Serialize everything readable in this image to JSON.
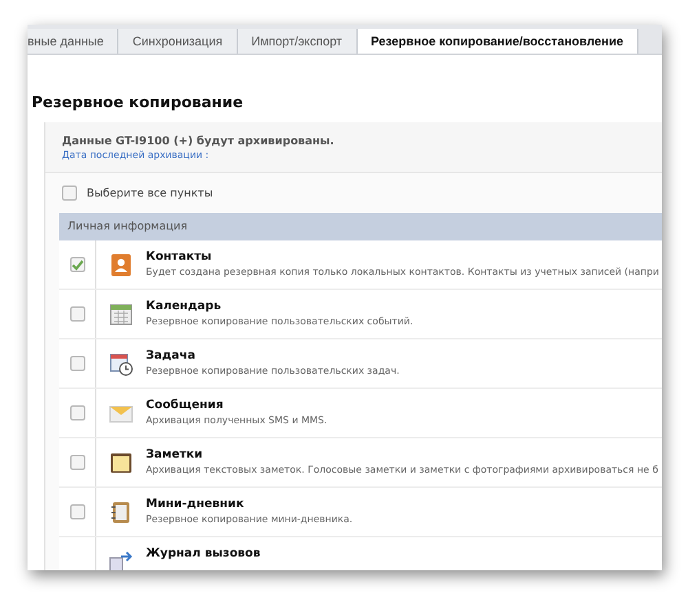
{
  "tabs": [
    {
      "label": "вные данные",
      "selected": false
    },
    {
      "label": "Синхронизация",
      "selected": false
    },
    {
      "label": "Импорт/экспорт",
      "selected": false
    },
    {
      "label": "Резервное копирование/восстановление",
      "selected": true
    }
  ],
  "section_title": "Резервное копирование",
  "info": {
    "message": "Данные GT-I9100 (+)  будут архивированы.",
    "link": "Дата последней архивации :"
  },
  "select_all": {
    "label": "Выберите все пункты",
    "checked": false
  },
  "group": {
    "title": "Личная информация",
    "items": [
      {
        "kind": "contacts",
        "title": "Контакты",
        "description": "Будет создана резервная копия только локальных контактов. Контакты из учетных записей (напри",
        "checked": true
      },
      {
        "kind": "calendar",
        "title": "Календарь",
        "description": "Резервное копирование пользовательских событий.",
        "checked": false
      },
      {
        "kind": "task",
        "title": "Задача",
        "description": "Резервное копирование пользовательских задач.",
        "checked": false
      },
      {
        "kind": "messages",
        "title": "Сообщения",
        "description": "Архивация полученных SMS и MMS.",
        "checked": false
      },
      {
        "kind": "notes",
        "title": "Заметки",
        "description": "Архивация текстовых заметок. Голосовые заметки и заметки с фотографиями архивироваться не б",
        "checked": false
      },
      {
        "kind": "diary",
        "title": "Мини-дневник",
        "description": "Резервное копирование мини-дневника.",
        "checked": false
      },
      {
        "kind": "calls",
        "title": "Журнал вызовов"
      }
    ]
  }
}
